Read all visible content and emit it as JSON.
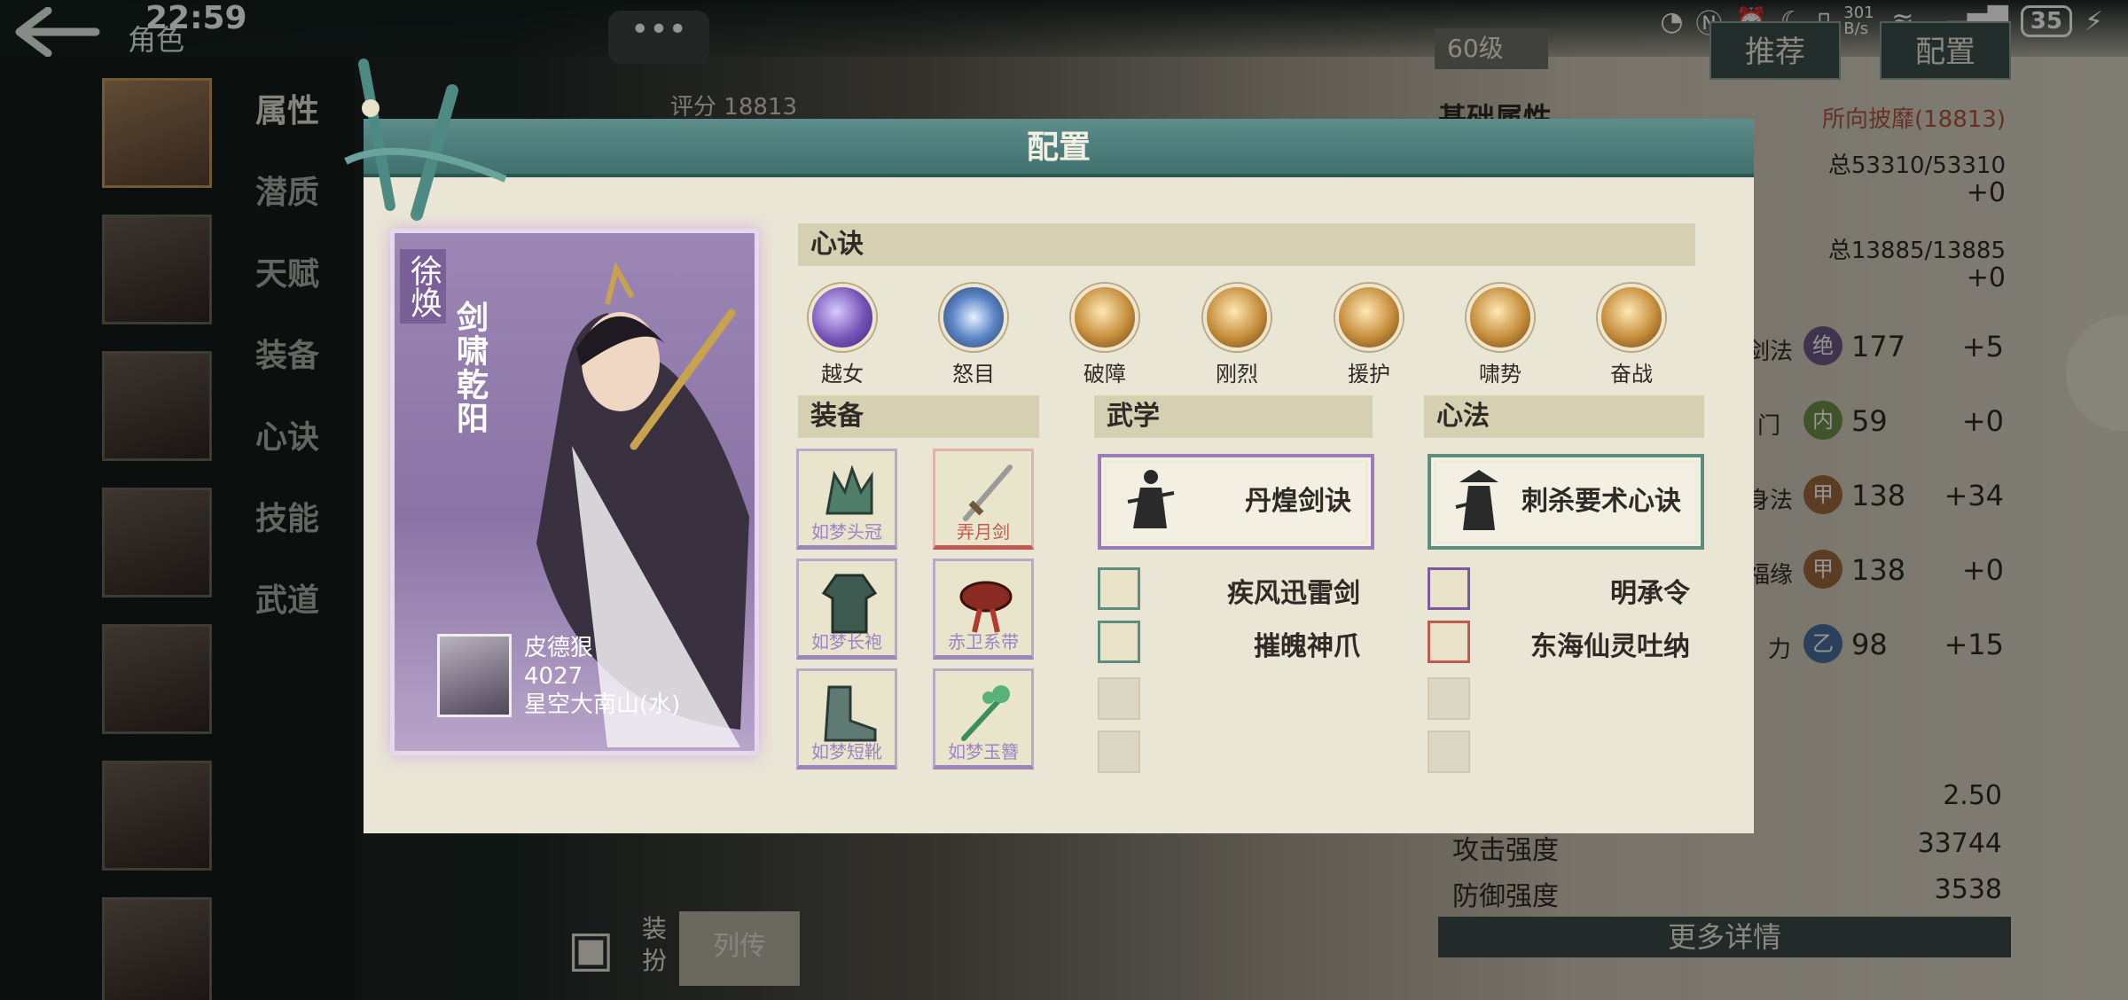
{
  "status_bar": {
    "time": "22:59",
    "speed": "301 B/s",
    "battery": "35",
    "icons": [
      "nfc-icon",
      "n-icon",
      "alarm-icon",
      "moon-icon",
      "vibrate-icon",
      "speed-icon",
      "wifi-icon",
      "signal-5g-icon",
      "battery-icon",
      "charging-icon"
    ]
  },
  "header": {
    "back_icon": "arrow-left-icon",
    "title": "角色"
  },
  "nav": {
    "items": [
      {
        "label": "属性",
        "active": true
      },
      {
        "label": "潜质"
      },
      {
        "label": "天赋"
      },
      {
        "label": "装备"
      },
      {
        "label": "心诀"
      },
      {
        "label": "技能"
      },
      {
        "label": "武道"
      }
    ],
    "portraits": 7
  },
  "chat_bubble": "•••",
  "score_label": "评分",
  "score_value": "18813",
  "level": "60级",
  "top_buttons": {
    "recommend": "推荐",
    "config": "配置"
  },
  "stats": {
    "heading": "基础属性",
    "faction": "所向披靡(18813)",
    "hp_total": "总53310/53310",
    "hp_bonus": "+0",
    "mp_total": "总13885/13885",
    "mp_bonus": "+0",
    "attributes": [
      {
        "label_fragment": "剑法",
        "badge": "绝",
        "value": "177",
        "bonus": "+5"
      },
      {
        "label_fragment": "门",
        "badge": "内",
        "value": "59",
        "bonus": "+0"
      },
      {
        "label_fragment": "身法",
        "badge": "甲",
        "value": "138",
        "bonus": "+34"
      },
      {
        "label_fragment": "福缘",
        "badge": "甲",
        "value": "138",
        "bonus": "+0"
      },
      {
        "label_fragment": "力",
        "badge": "乙",
        "value": "98",
        "bonus": "+15"
      }
    ],
    "details": [
      {
        "label": "",
        "value": "2.50"
      },
      {
        "label": "攻击强度",
        "value": "33744"
      },
      {
        "label": "防御强度",
        "value": "3538"
      }
    ],
    "more_details": "更多详情"
  },
  "bottom_buttons": {
    "dress": "装扮",
    "biography": "列传"
  },
  "modal": {
    "title": "配置",
    "character": {
      "name": "徐焕",
      "title": "剑啸乾阳",
      "player_name": "皮德狠",
      "player_id": "4027",
      "server": "星空大南山(水)"
    },
    "heart_section": "心诀",
    "heart_skills": [
      {
        "label": "越女",
        "style": "purple",
        "icon": "crescent-icon"
      },
      {
        "label": "怒目",
        "style": "blue",
        "icon": "eye-icon"
      },
      {
        "label": "破障",
        "style": "gold",
        "icon": "fist-icon"
      },
      {
        "label": "刚烈",
        "style": "gold",
        "icon": "mask-icon"
      },
      {
        "label": "援护",
        "style": "gold",
        "icon": "hand-icon"
      },
      {
        "label": "啸势",
        "style": "gold",
        "icon": "tiger-icon"
      },
      {
        "label": "奋战",
        "style": "gold",
        "icon": "warrior-icon"
      }
    ],
    "equip_section": "装备",
    "equipment": [
      {
        "label": "如梦头冠",
        "quality": "purple",
        "icon": "crown-icon"
      },
      {
        "label": "弄月剑",
        "quality": "red",
        "icon": "sword-icon"
      },
      {
        "label": "如梦长袍",
        "quality": "purple",
        "icon": "robe-icon"
      },
      {
        "label": "赤卫系带",
        "quality": "purple",
        "icon": "belt-icon"
      },
      {
        "label": "如梦短靴",
        "quality": "purple",
        "icon": "boots-icon"
      },
      {
        "label": "如梦玉簪",
        "quality": "purple",
        "icon": "hairpin-icon"
      }
    ],
    "martial_section": "武学",
    "martial_main": "丹煌剑诀",
    "martial_subs": [
      "疾风迅雷剑",
      "摧魄神爪"
    ],
    "heart_method_section": "心法",
    "heart_method_main": "刺杀要术心诀",
    "heart_method_subs": [
      "明承令",
      "东海仙灵吐纳"
    ]
  },
  "colors": {
    "modal_header": "#4f807d",
    "modal_bg": "#e9e6d6",
    "card_purple": "#8a74a6",
    "quality_purple": "#9c86b8",
    "quality_red": "#c2594f",
    "quality_green": "#5e8d80"
  }
}
